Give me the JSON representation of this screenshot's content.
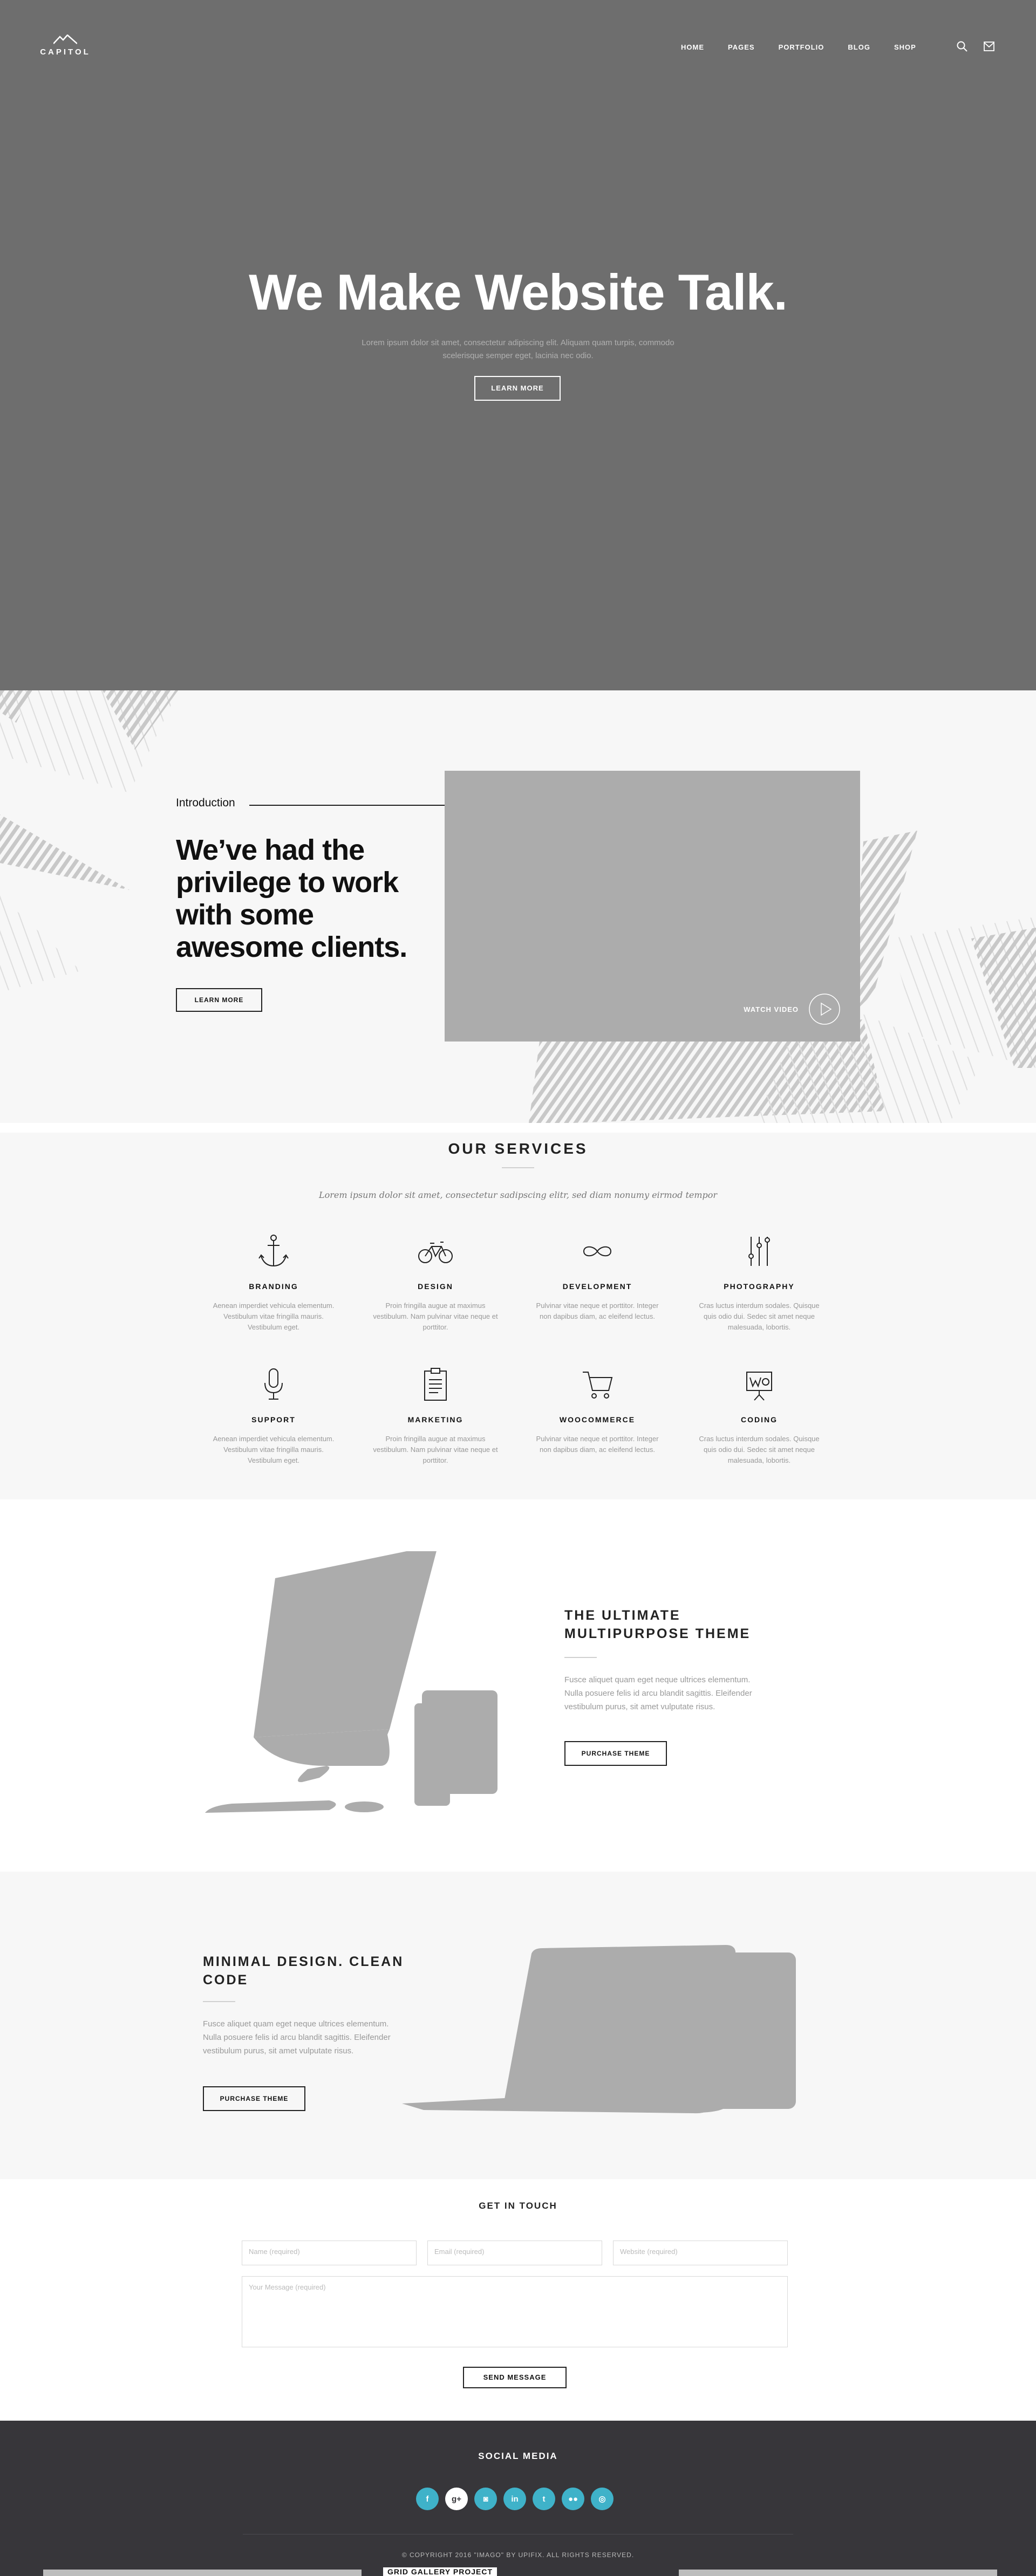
{
  "header": {
    "logo_text": "CAPITOL",
    "nav": [
      {
        "label": "HOME"
      },
      {
        "label": "PAGES"
      },
      {
        "label": "PORTFOLIO"
      },
      {
        "label": "BLOG"
      },
      {
        "label": "SHOP"
      }
    ],
    "icons": [
      "search-icon",
      "mail-icon"
    ]
  },
  "hero": {
    "title": "We Make Website Talk.",
    "subtitle": "Lorem ipsum dolor sit amet, consectetur adipiscing elit. Aliquam quam turpis, commodo scelerisque semper eget, lacinia nec odio.",
    "button": "LEARN MORE"
  },
  "intro": {
    "label": "Introduction",
    "heading": "We’ve had the privilege to work with some awesome clients.",
    "button": "LEARN MORE",
    "watch_video": "WATCH VIDEO"
  },
  "services": {
    "title": "OUR SERVICES",
    "tagline": "Lorem ipsum dolor sit amet, consectetur sadipscing elitr, sed diam nonumy eirmod tempor",
    "items": [
      {
        "name": "BRANDING",
        "icon": "anchor-icon",
        "desc": "Aenean imperdiet vehicula elementum. Vestibulum vitae fringilla mauris. Vestibulum eget."
      },
      {
        "name": "DESIGN",
        "icon": "bicycle-icon",
        "desc": "Proin fringilla augue at maximus vestibulum. Nam pulvinar vitae neque et porttitor."
      },
      {
        "name": "DEVELOPMENT",
        "icon": "infinity-icon",
        "desc": "Pulvinar vitae neque et porttitor. Integer non dapibus diam, ac eleifend lectus."
      },
      {
        "name": "PHOTOGRAPHY",
        "icon": "sliders-icon",
        "desc": "Cras luctus interdum sodales. Quisque quis odio dui. Sedec sit amet neque malesuada, lobortis."
      },
      {
        "name": "SUPPORT",
        "icon": "microphone-icon",
        "desc": "Aenean imperdiet vehicula elementum. Vestibulum vitae fringilla mauris. Vestibulum eget."
      },
      {
        "name": "MARKETING",
        "icon": "clipboard-icon",
        "desc": "Proin fringilla augue at maximus vestibulum. Nam pulvinar vitae neque et porttitor."
      },
      {
        "name": "WOOCOMMERCE",
        "icon": "cart-icon",
        "desc": "Pulvinar vitae neque et porttitor. Integer non dapibus diam, ac eleifend lectus."
      },
      {
        "name": "CODING",
        "icon": "presentation-icon",
        "desc": "Cras luctus interdum sodales. Quisque quis odio dui. Sedec sit amet neque malesuada, lobortis."
      }
    ]
  },
  "ultimate": {
    "title": "THE ULTIMATE MULTIPURPOSE THEME",
    "desc": "Fusce aliquet quam eget neque ultrices elementum. Nulla posuere felis id arcu blandit sagittis. Eleifender vestibulum purus, sit amet vulputate risus.",
    "button": "PURCHASE THEME"
  },
  "minimal": {
    "title": "MINIMAL DESIGN. CLEAN CODE",
    "desc": "Fusce aliquet quam eget neque ultrices elementum. Nulla posuere felis id arcu blandit sagittis. Eleifender vestibulum purus, sit amet vulputate risus.",
    "button": "PURCHASE THEME"
  },
  "contact": {
    "title": "GET IN TOUCH",
    "name_placeholder": "Name (required)",
    "email_placeholder": "Email (required)",
    "website_placeholder": "Website (required)",
    "message_placeholder": "Your Message (required)",
    "button": "SEND MESSAGE"
  },
  "footer": {
    "title": "SOCIAL MEDIA",
    "socials": [
      {
        "icon": "facebook-icon",
        "glyph": "f"
      },
      {
        "icon": "google-plus-icon",
        "glyph": "g+"
      },
      {
        "icon": "instagram-icon",
        "glyph": "◙"
      },
      {
        "icon": "linkedin-icon",
        "glyph": "in"
      },
      {
        "icon": "twitter-icon",
        "glyph": "t"
      },
      {
        "icon": "flickr-icon",
        "glyph": "●●"
      },
      {
        "icon": "dribbble-icon",
        "glyph": "◎"
      }
    ],
    "copyright": "© COPYRIGHT 2016 \"IMAGO\" BY UPIFIX. ALL RIGHTS RESERVED.",
    "strip_text": "GRID GALLERY PROJECT"
  },
  "colors": {
    "hero_bg": "#6e6e6e",
    "section_alt_bg": "#f7f7f7",
    "footer_bg": "#37363a",
    "social_accent": "#3fb2c9",
    "placeholder_gray": "#acacac"
  }
}
